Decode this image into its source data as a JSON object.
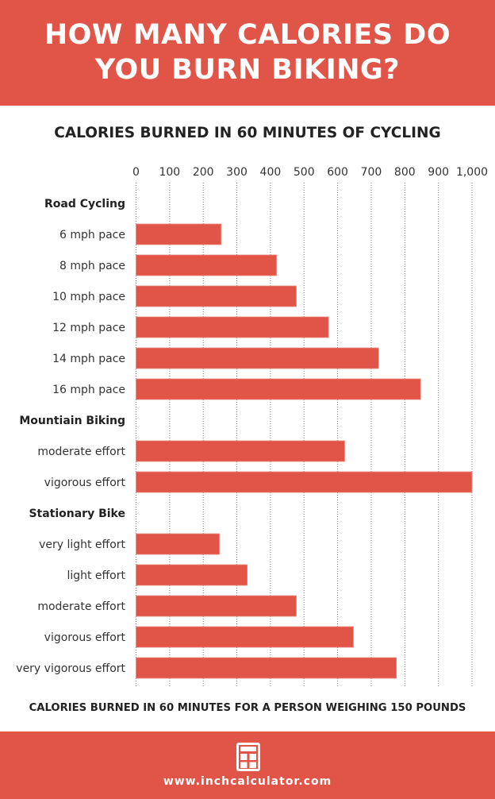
{
  "header": {
    "title_line1": "HOW MANY CALORIES DO",
    "title_line2": "YOU BURN BIKING?"
  },
  "footnote": "CALORIES BURNED IN 60 MINUTES FOR A PERSON WEIGHING 150 POUNDS",
  "footer": {
    "icon": "calculator-icon",
    "url": "www.inchcalculator.com"
  },
  "colors": {
    "accent": "#e05548",
    "text": "#222222",
    "grid": "#777777"
  },
  "chart_data": {
    "type": "bar",
    "orientation": "horizontal",
    "title": "CALORIES BURNED IN 60 MINUTES OF CYCLING",
    "xlabel": "",
    "ylabel": "",
    "xlim": [
      0,
      1000
    ],
    "grid": true,
    "grid_style": "dotted",
    "xticks": [
      0,
      100,
      200,
      300,
      400,
      500,
      600,
      700,
      800,
      900,
      1000
    ],
    "xtick_labels": [
      "0",
      "100",
      "200",
      "300",
      "400",
      "500",
      "600",
      "700",
      "800",
      "900",
      "1,000"
    ],
    "groups": [
      {
        "name": "Road Cycling",
        "categories": [
          "6 mph pace",
          "8 mph pace",
          "10 mph pace",
          "12 mph pace",
          "14 mph pace",
          "16 mph pace"
        ],
        "values": [
          253,
          418,
          477,
          573,
          722,
          847
        ]
      },
      {
        "name": "Mountiain Biking",
        "categories": [
          "moderate effort",
          "vigorous effort"
        ],
        "values": [
          621,
          1000
        ]
      },
      {
        "name": "Stationary Bike",
        "categories": [
          "very light effort",
          "light effort",
          "moderate effort",
          "vigorous effort",
          "very vigorous effort"
        ],
        "values": [
          248,
          331,
          477,
          647,
          775
        ]
      }
    ]
  }
}
